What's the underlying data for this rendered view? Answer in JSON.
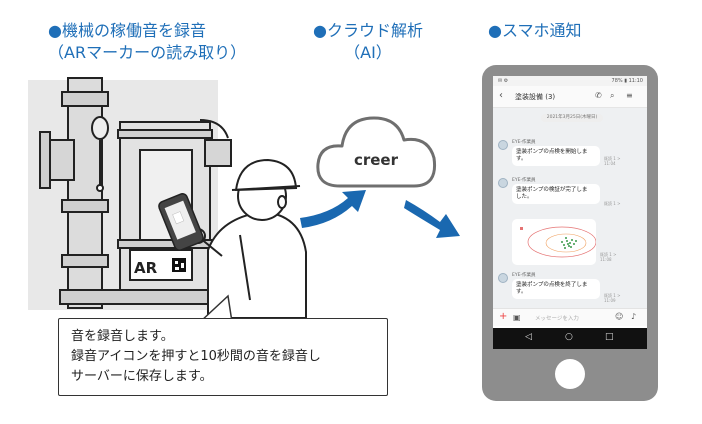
{
  "steps": {
    "step1": {
      "line1": "●機械の稼働音を録音",
      "line2": "（ARマーカーの読み取り）"
    },
    "step2": {
      "line1": "●クラウド解析",
      "line2": "（AI）"
    },
    "step3": {
      "line1": "●スマホ通知"
    }
  },
  "cloud_label": "creer",
  "ar_label": "AR",
  "callout": {
    "line1": "音を録音します。",
    "line2": "録音アイコンを押すと10秒間の音を録音し",
    "line3": "サーバーに保存します。"
  },
  "phone": {
    "status_time": "11:10",
    "status_battery": "78%",
    "chat_title": "塗装設備 (3)",
    "date": "2021年3月25日(木曜日)",
    "messages": [
      {
        "sender": "EYE-作業員",
        "text1": "塗装ポンプの点検を開始しま",
        "text2": "す。",
        "read": "既読 1 >",
        "time": "11:04"
      },
      {
        "sender": "EYE-作業員",
        "text1": "塗装ポンプの検証が完了しま",
        "text2": "した。",
        "read": "既読 1 >",
        "time": "11:05"
      },
      {
        "sender": "",
        "text1": "",
        "text2": "",
        "read": "既読 1 >",
        "time": "11:08"
      },
      {
        "sender": "EYE-作業員",
        "text1": "塗装ポンプの点検を終了しま",
        "text2": "す。",
        "read": "既読 1 >",
        "time": "11:09"
      }
    ],
    "input_placeholder": "メッセージを入力"
  },
  "colors": {
    "accent": "#1f6fb8",
    "arrow": "#1a68b0",
    "phone_body": "#8d8d8d"
  }
}
